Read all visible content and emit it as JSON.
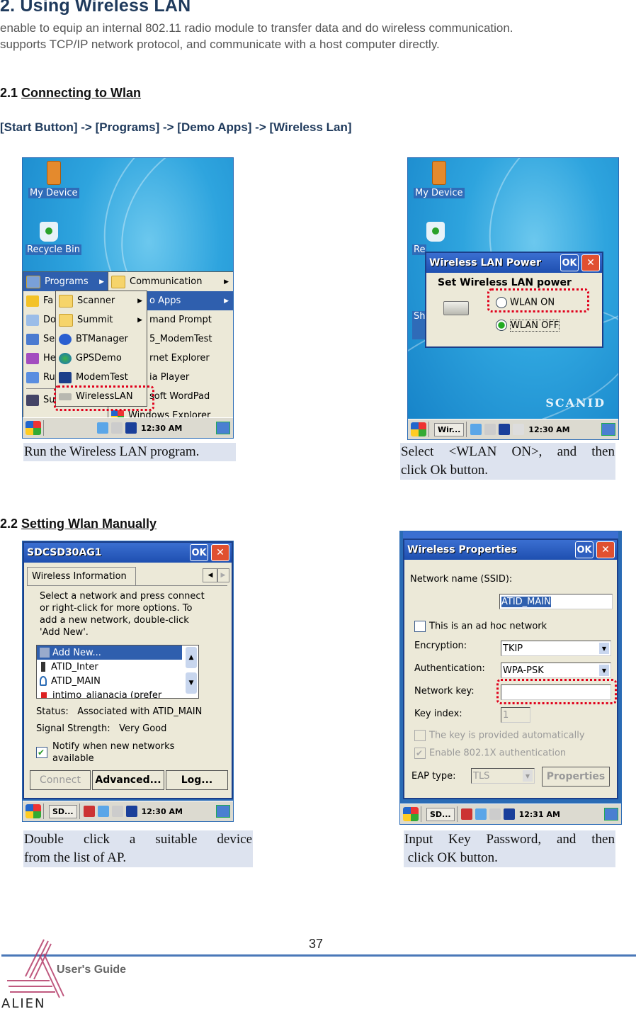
{
  "heading": "2. Using Wireless LAN",
  "intro": [
    " enable to equip an internal 802.11 radio module to transfer data and do wireless communication.",
    "supports TCP/IP network protocol, and communicate with a host computer directly."
  ],
  "section1": {
    "number": "2.1",
    "title": "Connecting to Wlan"
  },
  "nav_path": "[Start Button] -> [Programs] -> [Demo Apps] -> [Wireless Lan]",
  "section2": {
    "number": "2.2",
    "title": "Setting Wlan Manually"
  },
  "screen1": {
    "desktop_icons": [
      "My Device",
      "Recycle Bin"
    ],
    "start_menu": [
      "Programs",
      "Fa",
      "Do",
      "Se",
      "He",
      "Ru",
      "Suspend"
    ],
    "programs_menu": [
      "Communication",
      "Demo Apps",
      "Command Prompt",
      "5_ModemTest",
      "Internet Explorer",
      "Media Player",
      "Microsoft WordPad",
      "Windows Explorer"
    ],
    "programs_menu_visible": [
      "Communication",
      "o Apps",
      "mand Prompt",
      "5_ModemTest",
      "rnet Explorer",
      "ia Player",
      "soft WordPad",
      "Windows Explorer"
    ],
    "demo_apps_menu": [
      "Scanner",
      "Summit",
      "BTManager",
      "GPSDemo",
      "ModemTest",
      "WirelessLAN"
    ],
    "highlighted_item": "WirelessLAN",
    "taskbar_time": "12:30 AM"
  },
  "screen2": {
    "desktop_icons": [
      "My Device",
      "Re",
      "Sh"
    ],
    "dialog_title": "Wireless LAN Power",
    "ok_label": "OK",
    "prompt": "Set Wireless LAN power",
    "options": [
      {
        "label": "WLAN ON",
        "selected": false
      },
      {
        "label": "WLAN OFF",
        "selected": true
      }
    ],
    "brand": "SCANID",
    "taskbar_task": "Wir...",
    "taskbar_time": "12:30 AM"
  },
  "screen3": {
    "dialog_title": "SDCSD30AG1",
    "ok_label": "OK",
    "tab": "Wireless Information",
    "instructions": [
      "Select a network and press connect",
      "or right-click for more options.  To",
      "add a new network, double-click",
      "'Add New'."
    ],
    "networks": [
      "Add New...",
      "ATID_Inter",
      "ATID_MAIN",
      "intimo_alianacia (prefer"
    ],
    "selected_network": "Add New...",
    "status_label": "Status:",
    "status_value": "Associated with ATID_MAIN",
    "signal_label": "Signal Strength:",
    "signal_value": "Very Good",
    "notify_label": [
      "Notify when new networks",
      "available"
    ],
    "notify_checked": true,
    "buttons": [
      "Connect",
      "Advanced...",
      "Log..."
    ],
    "taskbar_task": "SD...",
    "taskbar_time": "12:30 AM"
  },
  "screen4": {
    "dialog_title": "Wireless Properties",
    "ok_label": "OK",
    "ssid_label": "Network name (SSID):",
    "ssid_value": "ATID_MAIN",
    "adhoc_label": "This is an ad hoc network",
    "adhoc_checked": false,
    "encryption_label": "Encryption:",
    "encryption_value": "TKIP",
    "auth_label": "Authentication:",
    "auth_value": "WPA-PSK",
    "key_label": "Network key:",
    "key_value": "",
    "key_index_label": "Key index:",
    "key_index_value": "1",
    "auto_key_label": "The key is provided automatically",
    "auto_key_checked": false,
    "enable_8021x_label": "Enable 802.1X authentication",
    "enable_8021x_checked": true,
    "eap_label": "EAP type:",
    "eap_value": "TLS",
    "properties_label": "Properties",
    "taskbar_task": "SD...",
    "taskbar_time": "12:31 AM"
  },
  "captions": {
    "c1": "Run the Wireless LAN program.",
    "c2": [
      "Select <WLAN ON>, and then",
      "click Ok button."
    ],
    "c3": [
      "Double click a suitable device",
      "from the list of AP."
    ],
    "c4": [
      "Input Key Password, and then",
      " click OK button."
    ]
  },
  "footer": {
    "page_number": "37",
    "guide_label": "User's Guide",
    "logo_text": "ALIEN"
  }
}
